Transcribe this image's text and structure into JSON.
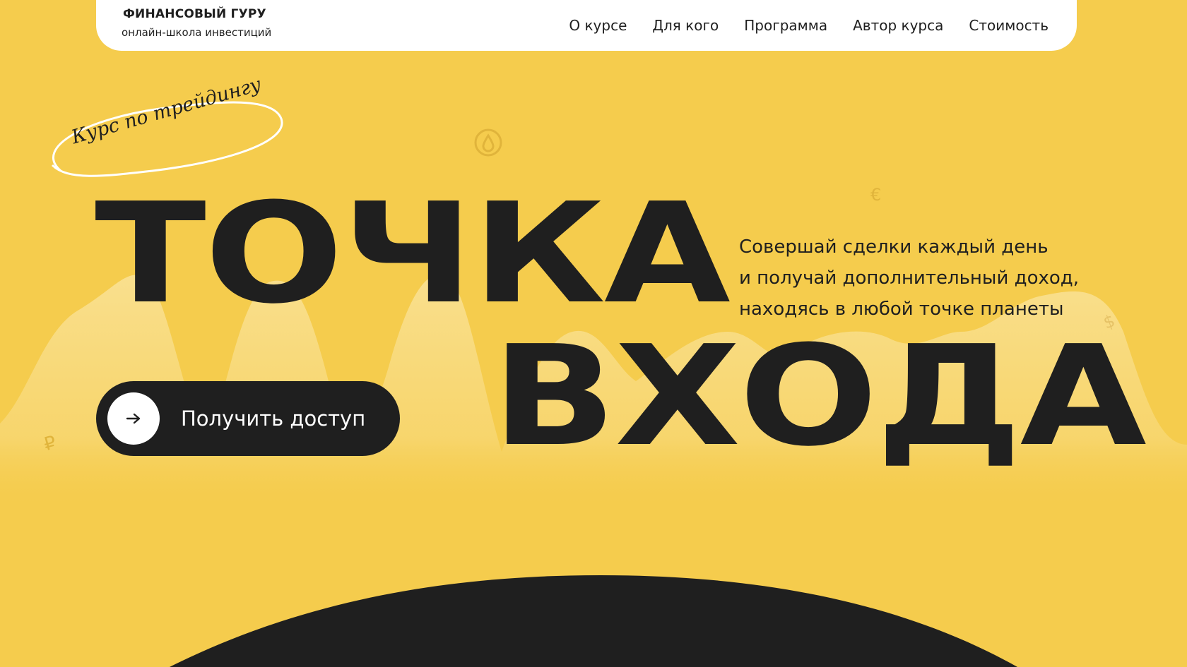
{
  "header": {
    "logo_title": "ФИНАНСОВЫЙ ГУРУ",
    "logo_subtitle": "онлайн-школа инвестиций",
    "nav": [
      {
        "label": "О курсе"
      },
      {
        "label": "Для кого"
      },
      {
        "label": "Программа"
      },
      {
        "label": "Автор курса"
      },
      {
        "label": "Стоимость"
      }
    ]
  },
  "hero": {
    "badge": "Курс по трейдингу",
    "title_line1": "ТОЧКА",
    "title_line2": "ВХОДА",
    "tagline": [
      "Совершай сделки каждый день",
      "и получай дополнительный доход,",
      "находясь в любой точке планеты"
    ],
    "cta_label": "Получить доступ",
    "cta_icon": "arrow-right-icon"
  },
  "decor": {
    "icons": [
      "drop-coin-icon",
      "euro-icon",
      "dollar-icon",
      "ruble-icon"
    ]
  },
  "colors": {
    "background": "#f5cc4d",
    "dark": "#1f1f1f",
    "white": "#ffffff"
  }
}
